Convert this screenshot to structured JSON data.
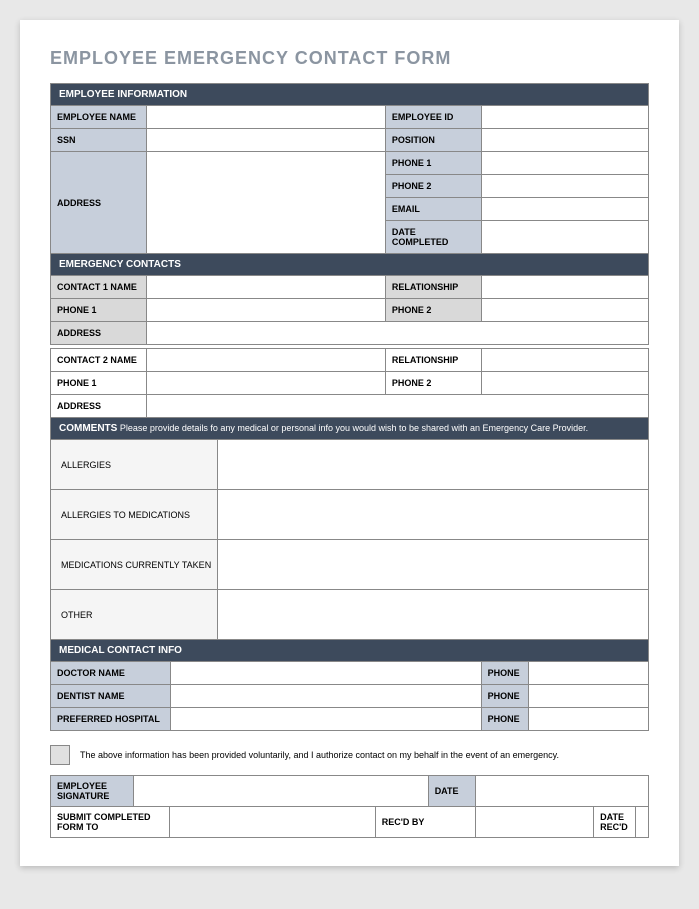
{
  "title": "EMPLOYEE EMERGENCY CONTACT FORM",
  "sections": {
    "employee_info": {
      "header": "EMPLOYEE INFORMATION",
      "employee_name": "EMPLOYEE NAME",
      "employee_id": "EMPLOYEE ID",
      "ssn": "SSN",
      "position": "POSITION",
      "address": "ADDRESS",
      "phone1": "PHONE 1",
      "phone2": "PHONE 2",
      "email": "EMAIL",
      "date_completed": "DATE COMPLETED"
    },
    "emergency_contacts": {
      "header": "EMERGENCY CONTACTS",
      "contact1_name": "CONTACT 1 NAME",
      "relationship": "RELATIONSHIP",
      "phone1": "PHONE 1",
      "phone2": "PHONE 2",
      "address": "ADDRESS",
      "contact2_name": "CONTACT 2 NAME"
    },
    "comments": {
      "header_bold": "COMMENTS",
      "header_rest": " Please provide details fo any medical or personal info you would wish to be shared with an Emergency Care Provider.",
      "allergies": "ALLERGIES",
      "allergies_meds": "ALLERGIES TO MEDICATIONS",
      "medications": "MEDICATIONS CURRENTLY TAKEN",
      "other": "OTHER"
    },
    "medical": {
      "header": "MEDICAL CONTACT INFO",
      "doctor": "DOCTOR NAME",
      "dentist": "DENTIST NAME",
      "hospital": "PREFERRED HOSPITAL",
      "phone": "PHONE"
    },
    "consent": "The above information has been provided voluntarily, and I authorize contact on my behalf in the event of an emergency.",
    "signature": {
      "employee_sig": "EMPLOYEE SIGNATURE",
      "date": "DATE",
      "submit_to": "SUBMIT COMPLETED FORM TO",
      "recd_by": "REC'D BY",
      "date_recd": "DATE REC'D"
    }
  }
}
